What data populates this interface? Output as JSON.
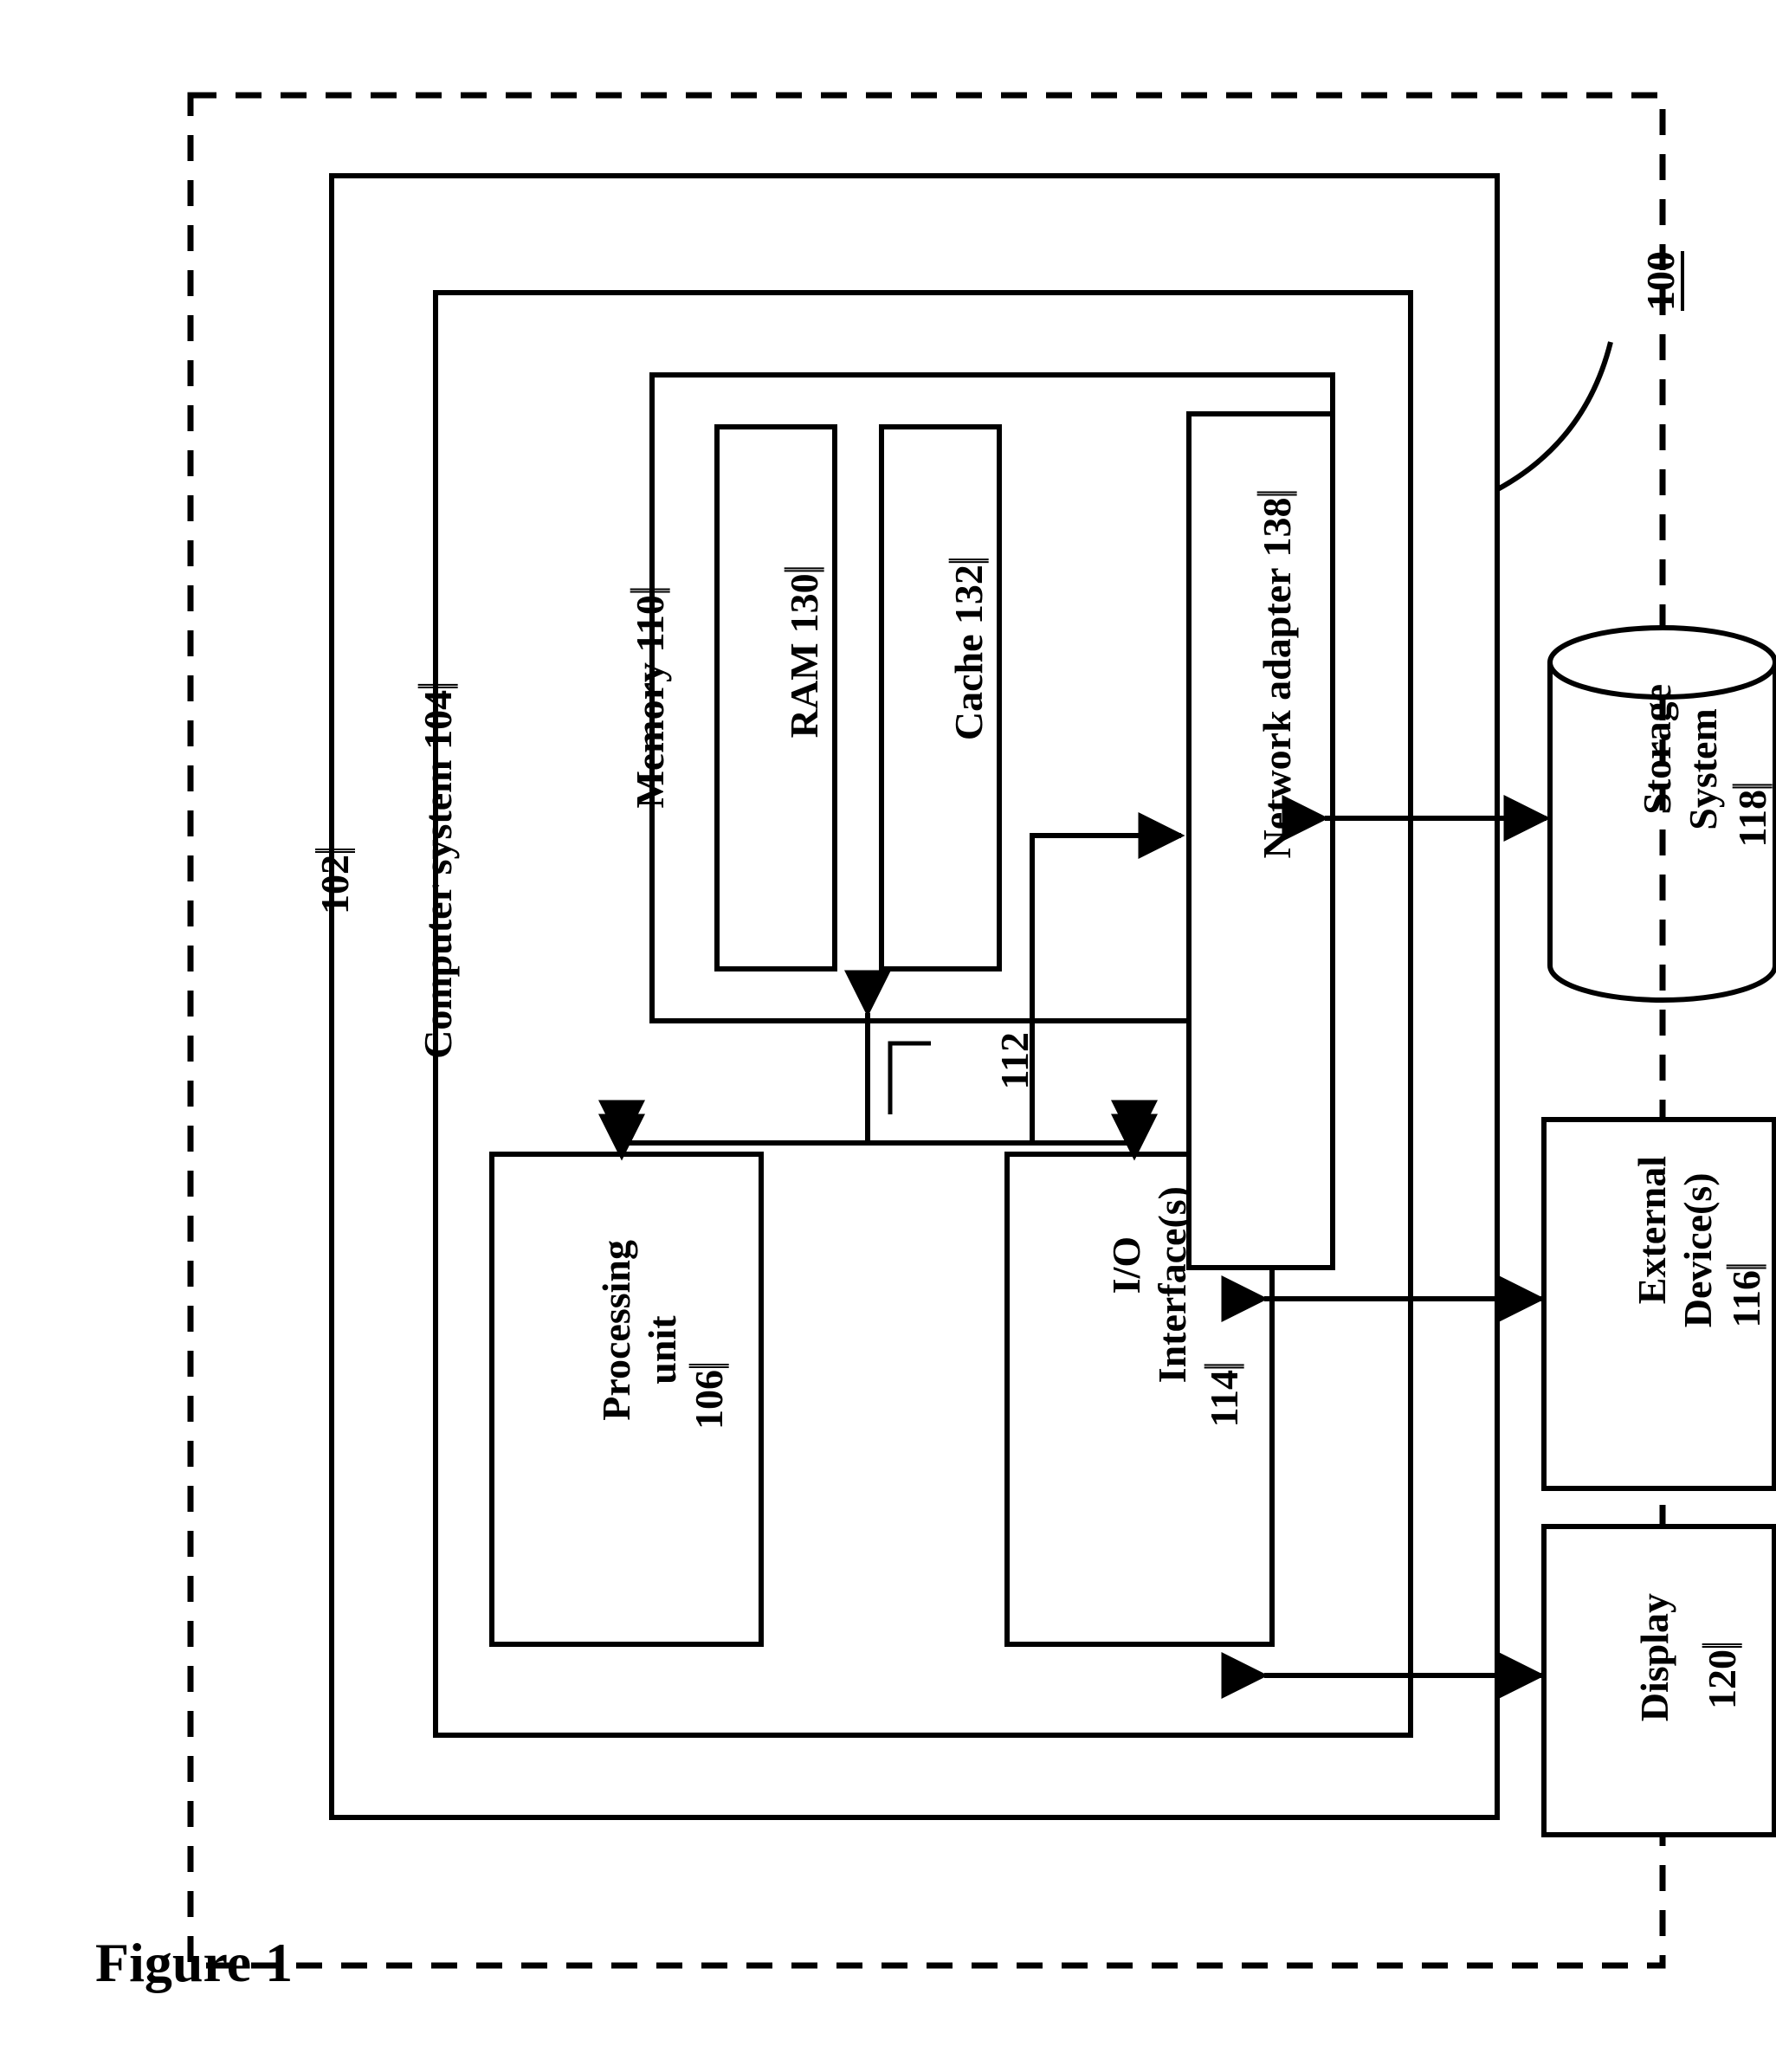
{
  "figure_title": "Figure 1",
  "refs": {
    "outer": "100",
    "server": "102",
    "bus": "112"
  },
  "blocks": {
    "computer_system": {
      "label": "Computer system",
      "num": "104"
    },
    "processing_unit": {
      "label": "Processing\nunit",
      "num": "106"
    },
    "memory": {
      "label": "Memory",
      "num": "110"
    },
    "ram": {
      "label": "RAM",
      "num": "130"
    },
    "cache": {
      "label": "Cache",
      "num": "132"
    },
    "io": {
      "label": "I/O\nInterface(s)",
      "num": "114"
    },
    "network": {
      "label": "Network adapter",
      "num": "138"
    },
    "display": {
      "label": "Display",
      "num": "120"
    },
    "external": {
      "label": "External\nDevice(s)",
      "num": "116"
    },
    "storage": {
      "label": "Storage\nSystem",
      "num": "118"
    }
  }
}
